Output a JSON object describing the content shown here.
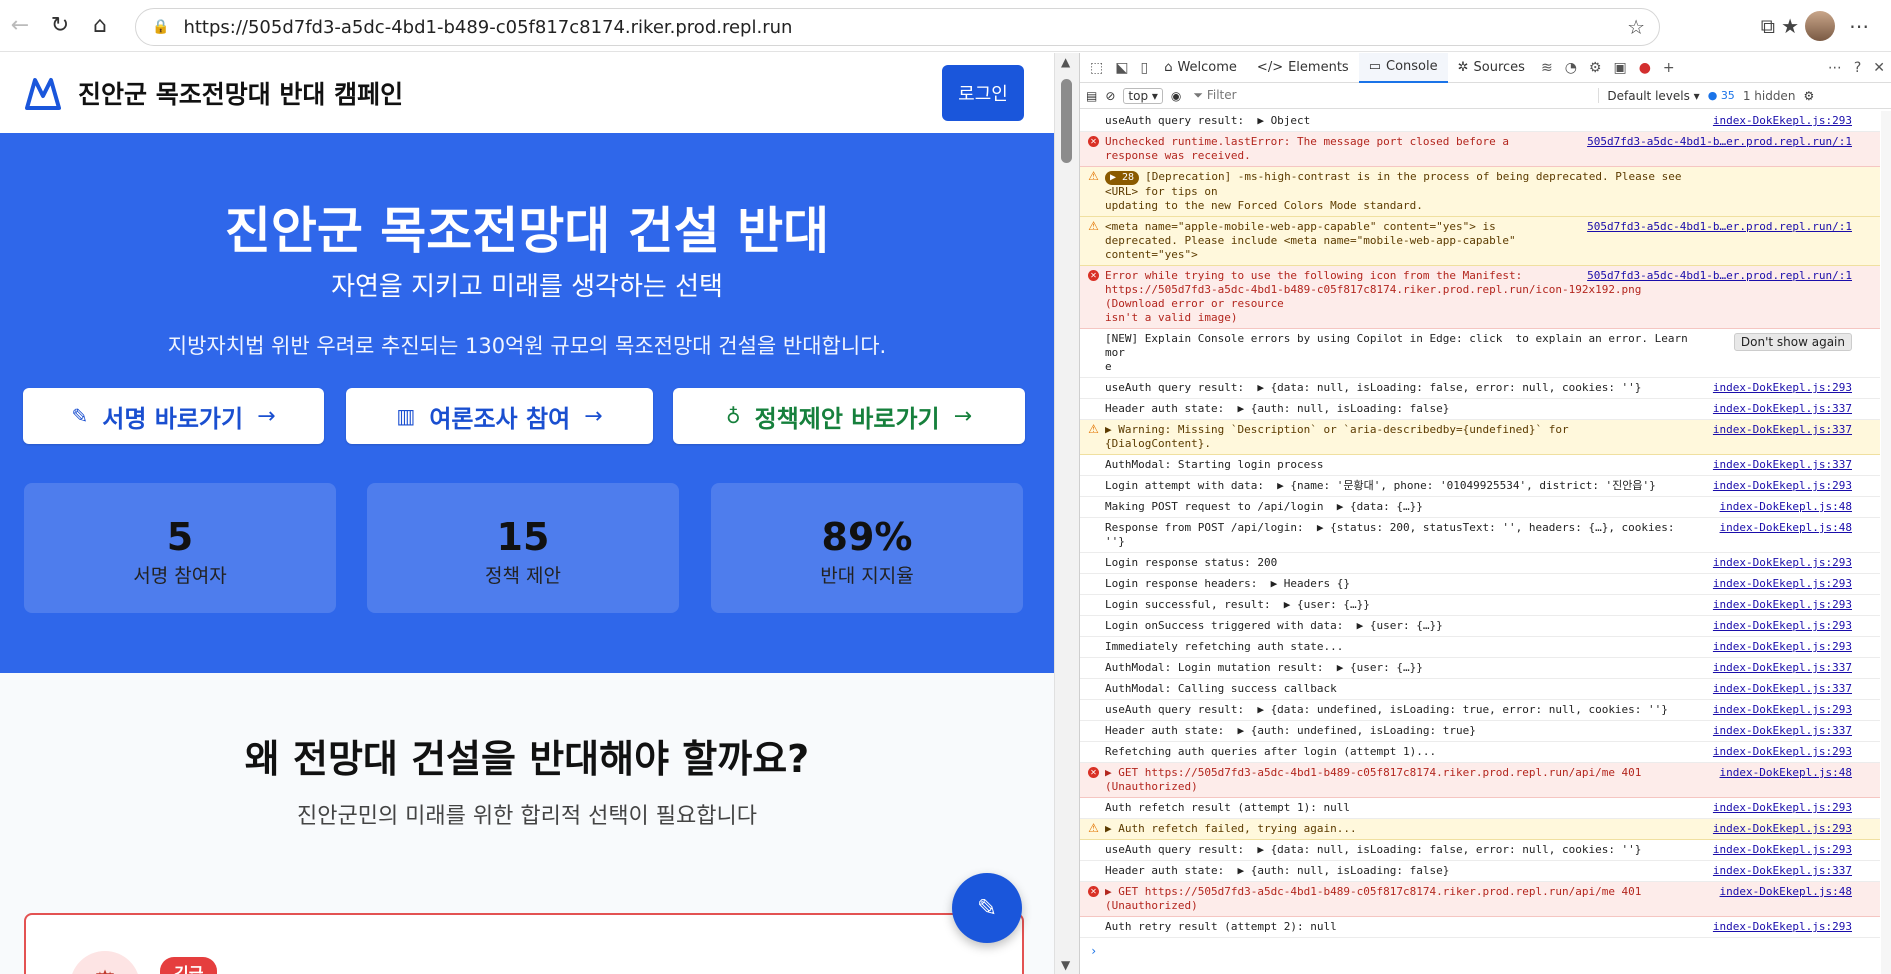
{
  "browser": {
    "url": "https://505d7fd3-a5dc-4bd1-b489-c05f817c8174.riker.prod.repl.run"
  },
  "site": {
    "title": "진안군 목조전망대 반대 캠페인",
    "login_label": "로그인"
  },
  "hero": {
    "title": "진안군 목조전망대 건설 반대",
    "subtitle": "자연을 지키고 미래를 생각하는 선택",
    "description": "지방자치법 위반 우려로 추진되는 130억원 규모의 목조전망대 건설을 반대합니다.",
    "buttons": [
      {
        "label": "서명 바로가기",
        "icon": "pen-icon"
      },
      {
        "label": "여론조사 참여",
        "icon": "bar-chart-icon"
      },
      {
        "label": "정책제안 바로가기",
        "icon": "lightbulb-icon"
      }
    ],
    "stats": [
      {
        "value": "5",
        "label": "서명 참여자"
      },
      {
        "value": "15",
        "label": "정책 제안"
      },
      {
        "value": "89%",
        "label": "반대 지지율"
      }
    ]
  },
  "why": {
    "title": "왜 전망대 건설을 반대해야 할까요?",
    "subtitle": "진안군민의 미래를 위한 합리적 선택이 필요합니다",
    "card_badge": "긴급"
  },
  "devtools": {
    "tabs": [
      "Welcome",
      "Elements",
      "Console",
      "Sources"
    ],
    "context": "top",
    "filter_placeholder": "Filter",
    "levels": "Default levels",
    "issues_count": "35",
    "hidden": "1 hidden",
    "dont_show": "Don't show again",
    "messages": [
      {
        "type": "log",
        "text": "useAuth query result:  ▶ Object",
        "src": "index-DokEkepl.js:293"
      },
      {
        "type": "err",
        "text": "Unchecked runtime.lastError: The message port closed before a\nresponse was received.",
        "src": "505d7fd3-a5dc-4bd1-b…er.prod.repl.run/:1"
      },
      {
        "type": "warn",
        "repeat": "28",
        "text": "[Deprecation] -ms-high-contrast is in the process of being deprecated. Please see <URL> for tips on\nupdating to the new Forced Colors Mode standard.",
        "src": ""
      },
      {
        "type": "warn",
        "text": "<meta name=\"apple-mobile-web-app-capable\" content=\"yes\"> is\ndeprecated. Please include <meta name=\"mobile-web-app-capable\"\ncontent=\"yes\">",
        "src": "505d7fd3-a5dc-4bd1-b…er.prod.repl.run/:1"
      },
      {
        "type": "err",
        "text": "Error while trying to use the following icon from the Manifest:\nhttps://505d7fd3-a5dc-4bd1-b489-c05f817c8174.riker.prod.repl.run/icon-192x192.png (Download error or resource\nisn't a valid image)",
        "src": "505d7fd3-a5dc-4bd1-b…er.prod.repl.run/:1"
      },
      {
        "type": "log",
        "text": "[NEW] Explain Console errors by using Copilot in Edge: click  to explain an error. Learn mor\ne",
        "src": "",
        "dont_show": true
      },
      {
        "type": "log",
        "text": "useAuth query result:  ▶ {data: null, isLoading: false, error: null, cookies: ''}",
        "src": "index-DokEkepl.js:293"
      },
      {
        "type": "log",
        "text": "Header auth state:  ▶ {auth: null, isLoading: false}",
        "src": "index-DokEkepl.js:337"
      },
      {
        "type": "warn",
        "text": "▶ Warning: Missing `Description` or `aria-describedby={undefined}` for {DialogContent}.",
        "src": "index-DokEkepl.js:337"
      },
      {
        "type": "log",
        "text": "AuthModal: Starting login process",
        "src": "index-DokEkepl.js:337"
      },
      {
        "type": "log",
        "text": "Login attempt with data:  ▶ {name: '문황대', phone: '01049925534', district: '진안읍'}",
        "src": "index-DokEkepl.js:293"
      },
      {
        "type": "log",
        "text": "Making POST request to /api/login  ▶ {data: {…}}",
        "src": "index-DokEkepl.js:48"
      },
      {
        "type": "log",
        "text": "Response from POST /api/login:  ▶ {status: 200, statusText: '', headers: {…}, cookies: ''}",
        "src": "index-DokEkepl.js:48"
      },
      {
        "type": "log",
        "text": "Login response status: 200",
        "src": "index-DokEkepl.js:293"
      },
      {
        "type": "log",
        "text": "Login response headers:  ▶ Headers {}",
        "src": "index-DokEkepl.js:293"
      },
      {
        "type": "log",
        "text": "Login successful, result:  ▶ {user: {…}}",
        "src": "index-DokEkepl.js:293"
      },
      {
        "type": "log",
        "text": "Login onSuccess triggered with data:  ▶ {user: {…}}",
        "src": "index-DokEkepl.js:293"
      },
      {
        "type": "log",
        "text": "Immediately refetching auth state...",
        "src": "index-DokEkepl.js:293"
      },
      {
        "type": "log",
        "text": "AuthModal: Login mutation result:  ▶ {user: {…}}",
        "src": "index-DokEkepl.js:337"
      },
      {
        "type": "log",
        "text": "AuthModal: Calling success callback",
        "src": "index-DokEkepl.js:337"
      },
      {
        "type": "log",
        "text": "useAuth query result:  ▶ {data: undefined, isLoading: true, error: null, cookies: ''}",
        "src": "index-DokEkepl.js:293"
      },
      {
        "type": "log",
        "text": "Header auth state:  ▶ {auth: undefined, isLoading: true}",
        "src": "index-DokEkepl.js:337"
      },
      {
        "type": "log",
        "text": "Refetching auth queries after login (attempt 1)...",
        "src": "index-DokEkepl.js:293"
      },
      {
        "type": "err",
        "text": "▶ GET https://505d7fd3-a5dc-4bd1-b489-c05f817c8174.riker.prod.repl.run/api/me 401\n(Unauthorized)",
        "src": "index-DokEkepl.js:48"
      },
      {
        "type": "log",
        "text": "Auth refetch result (attempt 1): null",
        "src": "index-DokEkepl.js:293"
      },
      {
        "type": "warn",
        "text": "▶ Auth refetch failed, trying again...",
        "src": "index-DokEkepl.js:293"
      },
      {
        "type": "log",
        "text": "useAuth query result:  ▶ {data: null, isLoading: false, error: null, cookies: ''}",
        "src": "index-DokEkepl.js:293"
      },
      {
        "type": "log",
        "text": "Header auth state:  ▶ {auth: null, isLoading: false}",
        "src": "index-DokEkepl.js:337"
      },
      {
        "type": "err",
        "text": "▶ GET https://505d7fd3-a5dc-4bd1-b489-c05f817c8174.riker.prod.repl.run/api/me 401\n(Unauthorized)",
        "src": "index-DokEkepl.js:48"
      },
      {
        "type": "log",
        "text": "Auth retry result (attempt 2): null",
        "src": "index-DokEkepl.js:293"
      }
    ]
  }
}
